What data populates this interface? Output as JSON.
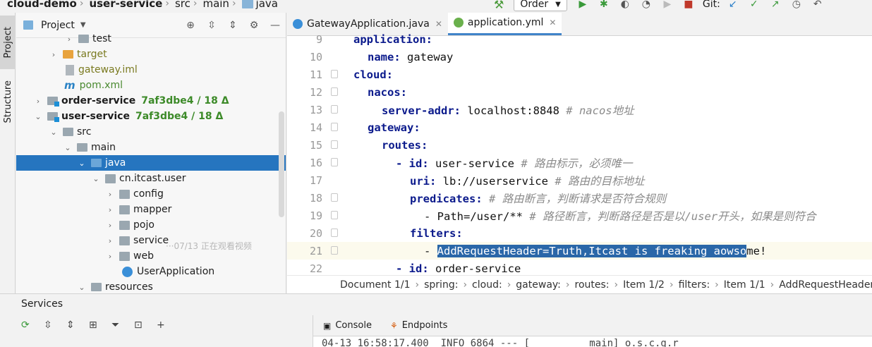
{
  "breadcrumb": [
    "cloud-demo",
    "user-service",
    "src",
    "main",
    "java"
  ],
  "toolbar": {
    "run_config": "Order",
    "git_label": "Git:"
  },
  "left_tabs": [
    "Project",
    "Structure"
  ],
  "project_panel": {
    "title": "Project"
  },
  "tree": [
    {
      "label": "test",
      "icon": "folder"
    },
    {
      "label": "target",
      "icon": "folder-orange"
    },
    {
      "label": "gateway.iml",
      "icon": "file"
    },
    {
      "label": "pom.xml",
      "icon": "maven"
    },
    {
      "label": "order-service",
      "git": "7af3dbe4 / 18 Δ",
      "icon": "module"
    },
    {
      "label": "user-service",
      "git": "7af3dbe4 / 18 Δ",
      "icon": "module"
    },
    {
      "label": "src",
      "icon": "folder"
    },
    {
      "label": "main",
      "icon": "folder"
    },
    {
      "label": "java",
      "icon": "source-folder"
    },
    {
      "label": "cn.itcast.user",
      "icon": "package"
    },
    {
      "label": "config",
      "icon": "package"
    },
    {
      "label": "mapper",
      "icon": "package"
    },
    {
      "label": "pojo",
      "icon": "package"
    },
    {
      "label": "service",
      "icon": "package"
    },
    {
      "label": "web",
      "icon": "package"
    },
    {
      "label": "UserApplication",
      "icon": "class"
    },
    {
      "label": "resources",
      "icon": "resources-folder"
    }
  ],
  "watermark": "···07/13 正在观看视频",
  "editor_tabs": [
    {
      "label": "GatewayApplication.java",
      "active": false
    },
    {
      "label": "application.yml",
      "active": true
    }
  ],
  "code_lines": [
    {
      "num": "9",
      "key": "application:",
      "val": "",
      "comment": ""
    },
    {
      "num": "10",
      "key": "name:",
      "val": " gateway",
      "comment": ""
    },
    {
      "num": "11",
      "key": "cloud:",
      "val": "",
      "comment": ""
    },
    {
      "num": "12",
      "key": "nacos:",
      "val": "",
      "comment": ""
    },
    {
      "num": "13",
      "key": "server-addr:",
      "val": " localhost:8848 ",
      "comment": "# nacos地址"
    },
    {
      "num": "14",
      "key": "gateway:",
      "val": "",
      "comment": ""
    },
    {
      "num": "15",
      "key": "routes:",
      "val": "",
      "comment": ""
    },
    {
      "num": "16",
      "key": "- id:",
      "val": " user-service ",
      "comment": "# 路由标示，必须唯一"
    },
    {
      "num": "17",
      "key": "uri:",
      "val": " lb://userservice ",
      "comment": "# 路由的目标地址"
    },
    {
      "num": "18",
      "key": "predicates:",
      "val": " ",
      "comment": "# 路由断言，判断请求是否符合规则"
    },
    {
      "num": "19",
      "key": "",
      "val": "- Path=/user/** ",
      "comment": "# 路径断言，判断路径是否是以/user开头，如果是则符合"
    },
    {
      "num": "20",
      "key": "filters:",
      "val": "",
      "comment": ""
    },
    {
      "num": "21",
      "key": "",
      "val": "- ",
      "selected": "AddRequestHeader=Truth,Itcast is freaking aowso",
      "rest": "me!",
      "comment": ""
    },
    {
      "num": "22",
      "key": "- id:",
      "val": " order-service",
      "comment": ""
    }
  ],
  "status_path": [
    "Document 1/1",
    "spring:",
    "cloud:",
    "gateway:",
    "routes:",
    "Item 1/2",
    "filters:",
    "Item 1/1",
    "AddRequestHeader="
  ],
  "services": {
    "title": "Services",
    "tabs": [
      "Console",
      "Endpoints"
    ],
    "log_line": "04-13 16:58:17.400  INFO 6864 --- [          main] o.s.c.g.r"
  }
}
